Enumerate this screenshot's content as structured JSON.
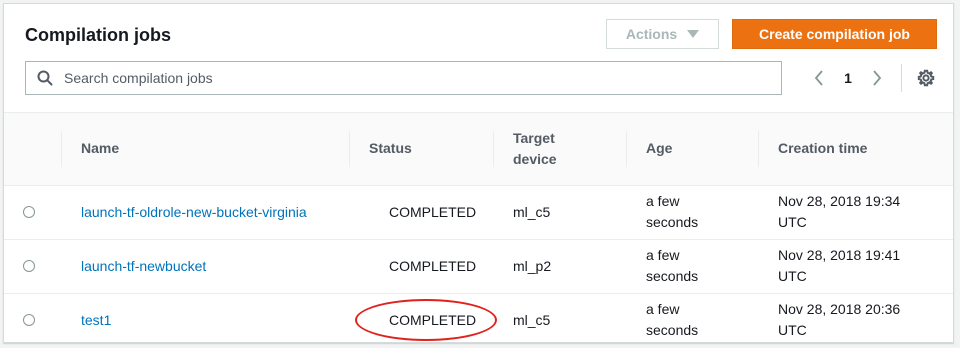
{
  "header": {
    "title": "Compilation jobs",
    "actions_label": "Actions",
    "create_label": "Create compilation job"
  },
  "search": {
    "placeholder": "Search compilation jobs",
    "value": ""
  },
  "pagination": {
    "current_page": "1"
  },
  "table": {
    "columns": [
      "Name",
      "Status",
      "Target device",
      "Age",
      "Creation time"
    ],
    "rows": [
      {
        "name": "launch-tf-oldrole-new-bucket-virginia",
        "status": "COMPLETED",
        "target_device": "ml_c5",
        "age": "a few seconds",
        "creation_time": "Nov 28, 2018 19:34 UTC"
      },
      {
        "name": "launch-tf-newbucket",
        "status": "COMPLETED",
        "target_device": "ml_p2",
        "age": "a few seconds",
        "creation_time": "Nov 28, 2018 19:41 UTC"
      },
      {
        "name": "test1",
        "status": "COMPLETED",
        "target_device": "ml_c5",
        "age": "a few seconds",
        "creation_time": "Nov 28, 2018 20:36 UTC"
      }
    ]
  },
  "colors": {
    "accent": "#ec7211",
    "link": "#0073bb",
    "annotation": "#e0221e"
  },
  "icons": [
    "search-icon",
    "chevron-left-icon",
    "chevron-right-icon",
    "gear-icon",
    "caret-down-icon"
  ]
}
